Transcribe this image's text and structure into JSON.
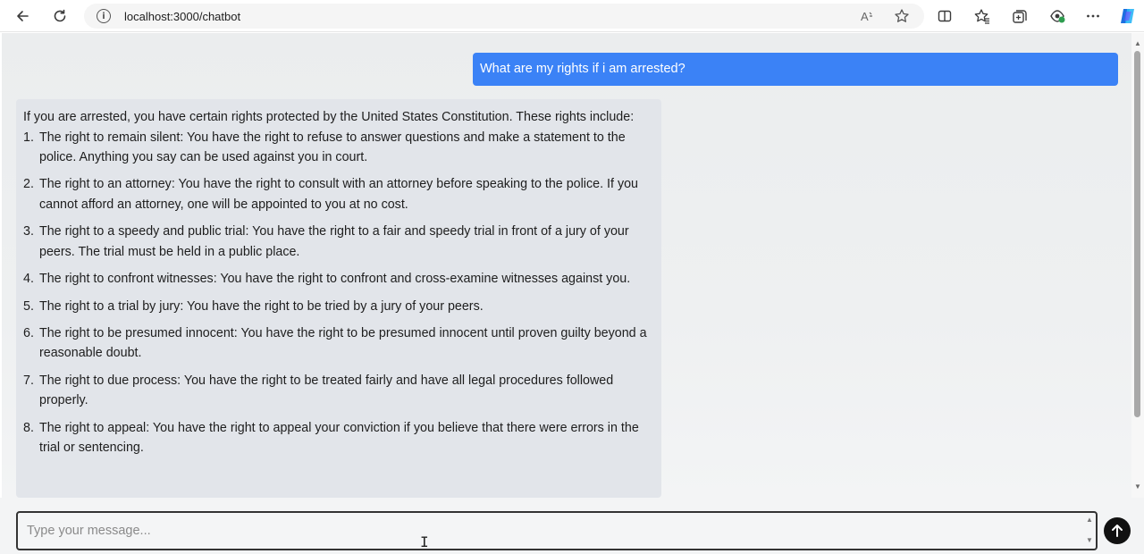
{
  "browser": {
    "url": "localhost:3000/chatbot",
    "icons": [
      "back-arrow-icon",
      "refresh-icon",
      "info-icon",
      "read-aloud-icon",
      "favorite-star-icon",
      "split-screen-icon",
      "favorites-icon",
      "collections-icon",
      "extensions-icon",
      "more-icon",
      "copilot-icon"
    ]
  },
  "chat": {
    "user_message": "What are my rights if i am arrested?",
    "bot_intro": "If you are arrested, you have certain rights protected by the United States Constitution. These rights include:",
    "bot_items": [
      {
        "num": "1.",
        "text": "The right to remain silent: You have the right to refuse to answer questions and make a statement to the police. Anything you say can be used against you in court."
      },
      {
        "num": "2.",
        "text": "The right to an attorney: You have the right to consult with an attorney before speaking to the police. If you cannot afford an attorney, one will be appointed to you at no cost."
      },
      {
        "num": "3.",
        "text": "The right to a speedy and public trial: You have the right to a fair and speedy trial in front of a jury of your peers. The trial must be held in a public place."
      },
      {
        "num": "4.",
        "text": "The right to confront witnesses: You have the right to confront and cross-examine witnesses against you."
      },
      {
        "num": "5.",
        "text": "The right to a trial by jury: You have the right to be tried by a jury of your peers."
      },
      {
        "num": "6.",
        "text": "The right to be presumed innocent: You have the right to be presumed innocent until proven guilty beyond a reasonable doubt."
      },
      {
        "num": "7.",
        "text": "The right to due process: You have the right to be treated fairly and have all legal procedures followed properly."
      },
      {
        "num": "8.",
        "text": "The right to appeal: You have the right to appeal your conviction if you believe that there were errors in the trial or sentencing."
      }
    ]
  },
  "input": {
    "placeholder": "Type your message...",
    "value": ""
  },
  "colors": {
    "user_bubble": "#3b82f6",
    "bot_bubble": "#e2e5ea",
    "send_button": "#111111"
  }
}
